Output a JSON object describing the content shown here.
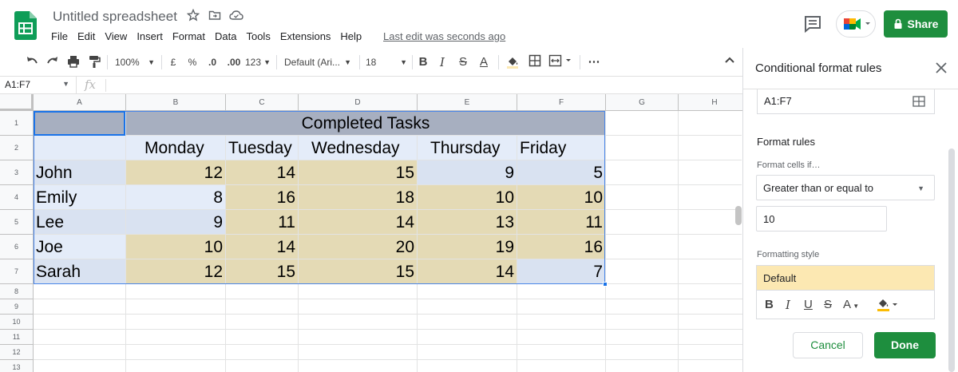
{
  "app": {
    "doc_title": "Untitled spreadsheet",
    "last_edit": "Last edit was seconds ago",
    "share_label": "Share",
    "brand_green": "#1e8e3e",
    "title_icons": [
      "star-icon",
      "move-folder-icon",
      "cloud-status-icon"
    ]
  },
  "menu": [
    "File",
    "Edit",
    "View",
    "Insert",
    "Format",
    "Data",
    "Tools",
    "Extensions",
    "Help"
  ],
  "toolbar": {
    "zoom": "100%",
    "currency": "£",
    "percent": "%",
    "decrease_decimal": ".0",
    "increase_decimal": ".00",
    "more_formats": "123",
    "font": "Default (Ari...",
    "font_size": "18"
  },
  "formula_bar": {
    "name_box": "A1:F7",
    "fx": "fx"
  },
  "sheet": {
    "columns": [
      "A",
      "B",
      "C",
      "D",
      "E",
      "F",
      "G",
      "H"
    ],
    "rows": [
      "1",
      "2",
      "3",
      "4",
      "5",
      "6",
      "7",
      "8",
      "9",
      "10",
      "11",
      "12",
      "13"
    ],
    "title": "Completed Tasks",
    "days": [
      "Monday",
      "Tuesday",
      "Wednesday",
      "Thursday",
      "Friday"
    ],
    "people": [
      {
        "name": "John",
        "values": [
          "12",
          "14",
          "15",
          "9",
          "5"
        ]
      },
      {
        "name": "Emily",
        "values": [
          "8",
          "16",
          "18",
          "10",
          "10"
        ]
      },
      {
        "name": "Lee",
        "values": [
          "9",
          "11",
          "14",
          "13",
          "11"
        ]
      },
      {
        "name": "Joe",
        "values": [
          "10",
          "14",
          "20",
          "19",
          "16"
        ]
      },
      {
        "name": "Sarah",
        "values": [
          "12",
          "15",
          "15",
          "14",
          "7"
        ]
      }
    ],
    "highlight_color": "#e4dab5",
    "header_color": "#a7afc0"
  },
  "panel": {
    "title": "Conditional format rules",
    "range": "A1:F7",
    "rules_label": "Format rules",
    "condition_label": "Format cells if…",
    "condition": "Greater than or equal to",
    "value": "10",
    "style_label": "Formatting style",
    "style_preview": "Default",
    "style_preview_color": "#fce8b2",
    "cancel_label": "Cancel",
    "done_label": "Done"
  }
}
